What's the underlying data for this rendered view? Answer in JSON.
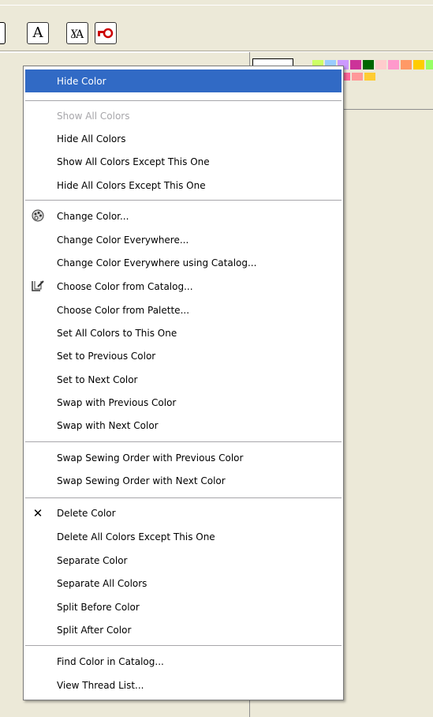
{
  "colors": {
    "menu_highlight": "#316ac5",
    "disabled_text": "#a7a6aa",
    "toolbar_lock_red": "#cc0000"
  },
  "toolbar": {
    "text_btn_glyph": "A",
    "text_edit_btn_glyph": "ƔA",
    "lock_icon": "key-icon"
  },
  "palette_swatches": [
    "#ccff66",
    "#99ccff",
    "#cc99ff",
    "#cc3399",
    "#006600",
    "#ffcccc",
    "#ff99cc",
    "#ff9966",
    "#ffcc00",
    "#99ff66",
    "#ff6699",
    "#ff9999",
    "#ffcc33"
  ],
  "menu": {
    "items": [
      {
        "label": "Hide Color",
        "icon": "",
        "state": "highlight"
      },
      {
        "label": "Show All Colors",
        "icon": "",
        "state": "disabled"
      },
      {
        "label": "Hide All Colors",
        "icon": "",
        "state": ""
      },
      {
        "label": "Show All Colors Except This One",
        "icon": "",
        "state": ""
      },
      {
        "label": "Hide All Colors Except This One",
        "icon": "",
        "state": ""
      },
      {
        "label": "Change Color...",
        "icon": "palette-icon",
        "state": ""
      },
      {
        "label": "Change Color Everywhere...",
        "icon": "",
        "state": ""
      },
      {
        "label": "Change Color Everywhere using Catalog...",
        "icon": "",
        "state": ""
      },
      {
        "label": "Choose Color from Catalog...",
        "icon": "catalog-icon",
        "state": ""
      },
      {
        "label": "Choose Color from Palette...",
        "icon": "",
        "state": ""
      },
      {
        "label": "Set All Colors to This One",
        "icon": "",
        "state": ""
      },
      {
        "label": "Set to Previous Color",
        "icon": "",
        "state": ""
      },
      {
        "label": "Set to Next Color",
        "icon": "",
        "state": ""
      },
      {
        "label": "Swap with Previous Color",
        "icon": "",
        "state": ""
      },
      {
        "label": "Swap with Next Color",
        "icon": "",
        "state": ""
      },
      {
        "label": "Swap Sewing Order with Previous Color",
        "icon": "",
        "state": ""
      },
      {
        "label": "Swap Sewing Order with Next Color",
        "icon": "",
        "state": ""
      },
      {
        "label": "Delete Color",
        "icon": "delete-x-icon",
        "state": ""
      },
      {
        "label": "Delete All Colors Except This One",
        "icon": "",
        "state": ""
      },
      {
        "label": "Separate Color",
        "icon": "",
        "state": ""
      },
      {
        "label": "Separate All Colors",
        "icon": "",
        "state": ""
      },
      {
        "label": "Split Before Color",
        "icon": "",
        "state": ""
      },
      {
        "label": "Split After Color",
        "icon": "",
        "state": ""
      },
      {
        "label": "Find Color in Catalog...",
        "icon": "",
        "state": ""
      },
      {
        "label": "View Thread List...",
        "icon": "",
        "state": ""
      }
    ]
  }
}
